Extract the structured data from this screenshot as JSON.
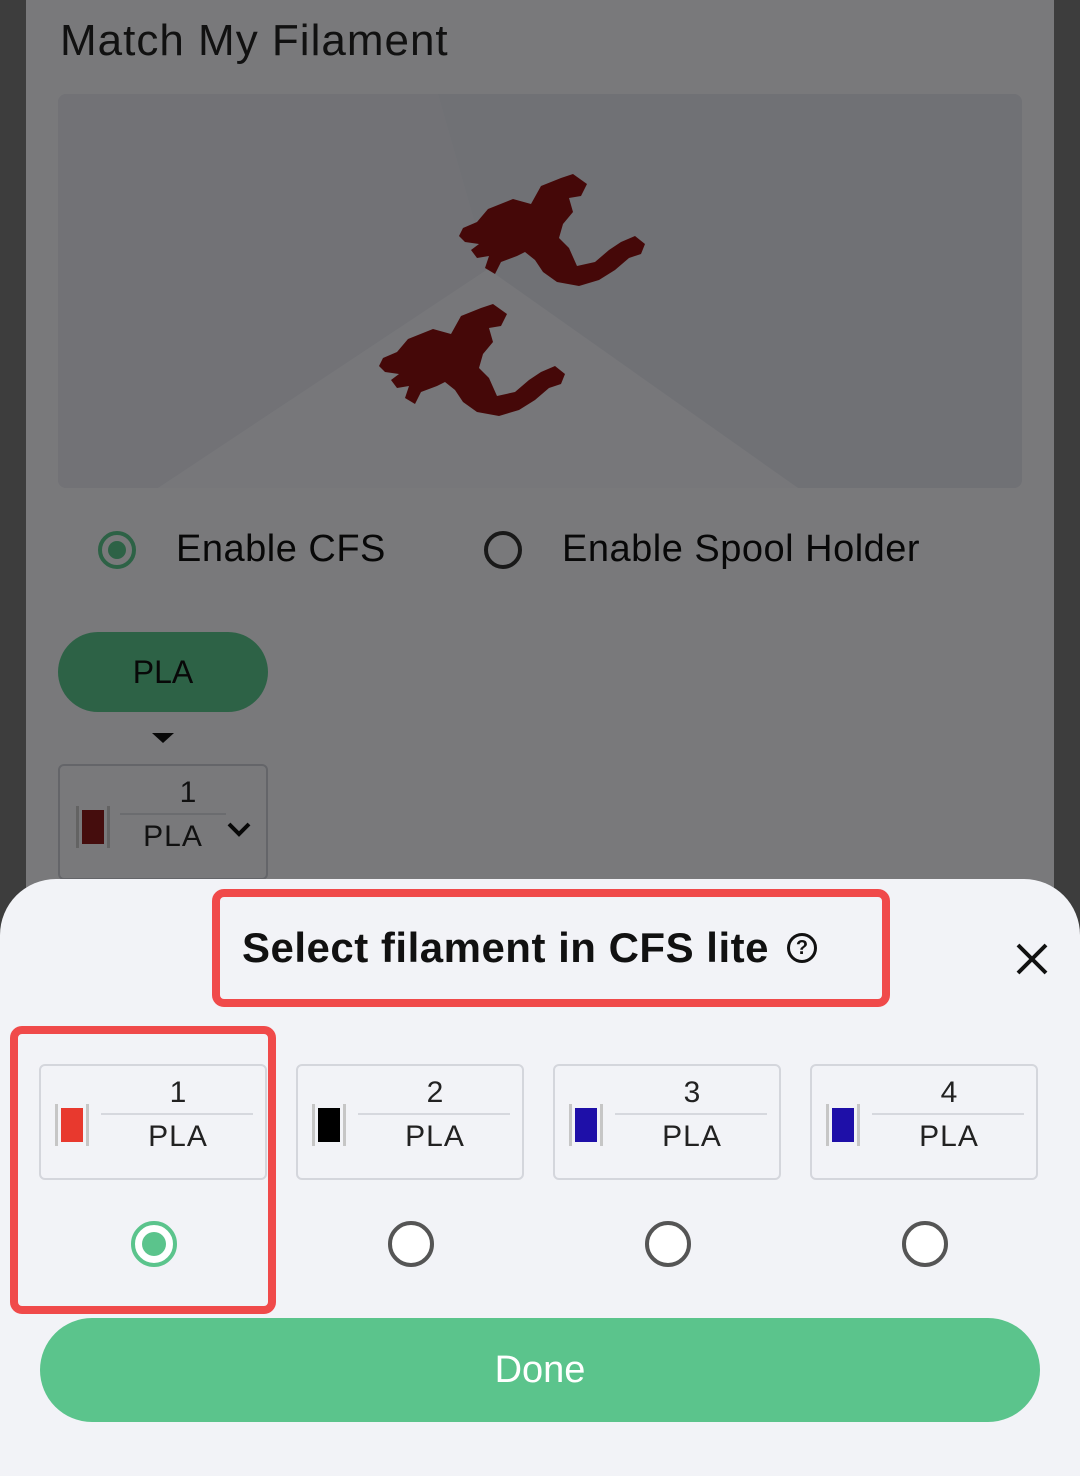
{
  "page": {
    "title": "Match My Filament",
    "options": {
      "enable_cfs": "Enable CFS",
      "enable_spool_holder": "Enable Spool Holder",
      "selected": "enable_cfs"
    },
    "material_pill": "PLA",
    "current_slot": {
      "number": "1",
      "material": "PLA",
      "color": "#8b1a1a"
    }
  },
  "sheet": {
    "title": "Select filament in CFS lite",
    "help_icon": "?",
    "close_icon": "close-icon",
    "slots": [
      {
        "number": "1",
        "material": "PLA",
        "color": "#e8392e",
        "selected": true
      },
      {
        "number": "2",
        "material": "PLA",
        "color": "#000000",
        "selected": false
      },
      {
        "number": "3",
        "material": "PLA",
        "color": "#1e0fa8",
        "selected": false
      },
      {
        "number": "4",
        "material": "PLA",
        "color": "#1e0fa8",
        "selected": false
      }
    ],
    "done_label": "Done",
    "accent": "#5bc48c",
    "highlight": "#f04a4a"
  }
}
